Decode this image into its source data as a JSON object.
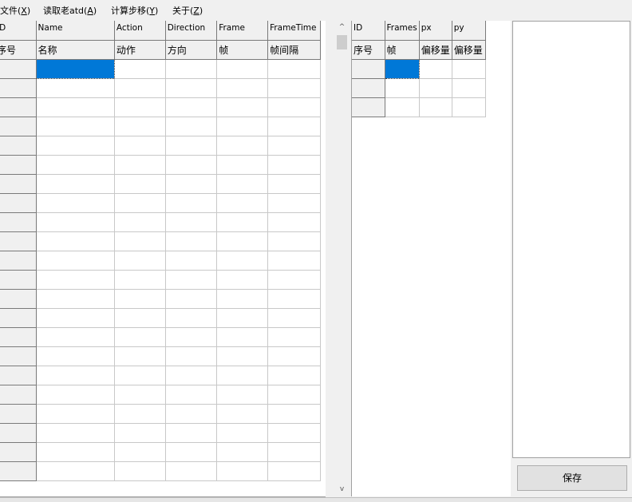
{
  "menu": [
    {
      "label": "文件(",
      "key": "X",
      "close": ")"
    },
    {
      "label": "读取老atd(",
      "key": "A",
      "close": ")"
    },
    {
      "label": "计算步移(",
      "key": "Y",
      "close": ")"
    },
    {
      "label": "关于(",
      "key": "Z",
      "close": ")"
    }
  ],
  "left_grid": {
    "headers_en": [
      "ID",
      "Name",
      "Action",
      "Direction",
      "Frame",
      "FrameTime"
    ],
    "headers_cn": [
      "序号",
      "名称",
      "动作",
      "方向",
      "帧",
      "帧间隔"
    ],
    "row_count": 22
  },
  "right_grid": {
    "headers_en": [
      "ID",
      "Frames",
      "px",
      "py"
    ],
    "headers_cn": [
      "序号",
      "帧",
      "偏移量",
      "偏移量"
    ],
    "row_count": 3
  },
  "scrollbar": {
    "up_arrow": "^",
    "down_arrow": "v"
  },
  "save_label": "保存"
}
